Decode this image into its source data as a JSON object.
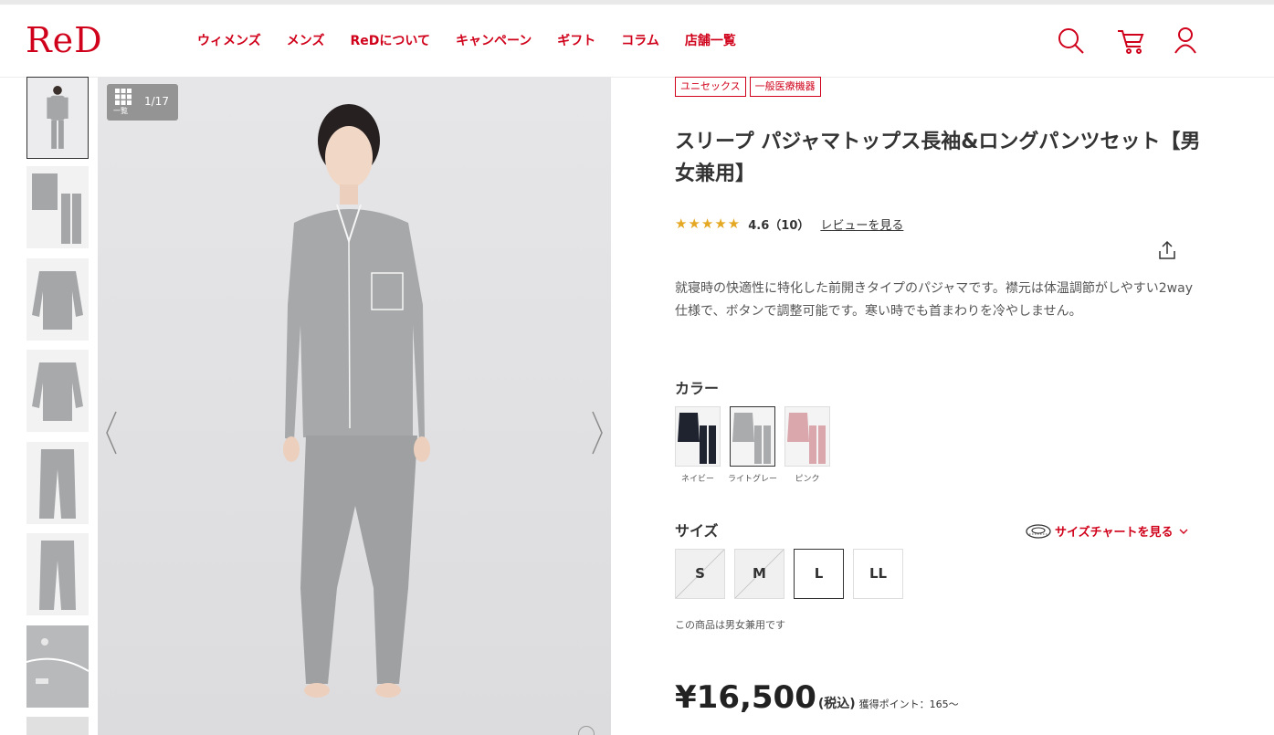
{
  "brand": {
    "logo": "ReD",
    "accent": "#d0021b"
  },
  "nav": [
    {
      "label": "ウィメンズ"
    },
    {
      "label": "メンズ"
    },
    {
      "label": "ReDについて"
    },
    {
      "label": "キャンペーン"
    },
    {
      "label": "ギフト"
    },
    {
      "label": "コラム"
    },
    {
      "label": "店舗一覧"
    }
  ],
  "header_icons": [
    "search-icon",
    "cart-icon",
    "user-icon"
  ],
  "gallery": {
    "index_label": "一覧",
    "counter": "1/17",
    "thumbnails": [
      {
        "name": "model-full"
      },
      {
        "name": "flat-set"
      },
      {
        "name": "top-front"
      },
      {
        "name": "top-back"
      },
      {
        "name": "pants-front"
      },
      {
        "name": "pants-back"
      },
      {
        "name": "detail-cuff"
      }
    ]
  },
  "product": {
    "tags": [
      "ユニセックス",
      "一般医療機器"
    ],
    "title": "スリープ パジャマトップス長袖&ロングパンツセット【男女兼用】",
    "rating": {
      "stars": "★★★★★",
      "value": 4.6,
      "text": "4.6（10）",
      "review_link": "レビューを見る"
    },
    "description": "就寝時の快適性に特化した前開きタイプのパジャマです。襟元は体温調節がしやすい2way仕様で、ボタンで調整可能です。寒い時でも首まわりを冷やしません。",
    "color_label": "カラー",
    "colors": [
      {
        "name": "ネイビー",
        "hex": "#1f2330"
      },
      {
        "name": "ライトグレー",
        "hex": "#a9abad",
        "selected": true
      },
      {
        "name": "ピンク",
        "hex": "#d9a7ac"
      }
    ],
    "size_label": "サイズ",
    "size_chart_link": "サイズチャートを見る",
    "sizes": [
      {
        "label": "S",
        "available": false
      },
      {
        "label": "M",
        "available": false
      },
      {
        "label": "L",
        "available": true,
        "selected": true
      },
      {
        "label": "LL",
        "available": true
      }
    ],
    "unisex_note": "この商品は男女兼用です",
    "price": "¥16,500",
    "tax_label": "(税込)",
    "points": "獲得ポイント：165〜"
  }
}
